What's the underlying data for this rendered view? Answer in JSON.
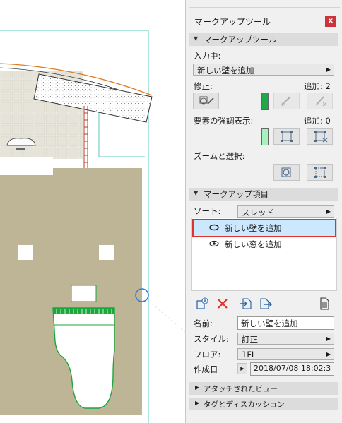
{
  "panel": {
    "title": "マークアップツール",
    "close_label": "x"
  },
  "markup_tool_section": {
    "header": "マークアップツール",
    "input_label": "入力中:",
    "input_value": "新しい壁を追加",
    "modify_label": "修正:",
    "added_label": "追加: 2",
    "highlight_label": "要素の強調表示:",
    "highlight_count": "追加: 0",
    "zoom_label": "ズームと選択:",
    "colors": {
      "modify_swatch": "#1faa4a",
      "highlight_swatch": "#a8f0c0"
    }
  },
  "markup_items_section": {
    "header": "マークアップ項目",
    "sort_label": "ソート:",
    "sort_value": "スレッド",
    "items": [
      {
        "label": "新しい壁を追加",
        "selected": true
      },
      {
        "label": "新しい窓を追加",
        "selected": false
      }
    ]
  },
  "properties": {
    "name_label": "名前:",
    "name_value": "新しい壁を追加",
    "style_label": "スタイル:",
    "style_value": "訂正",
    "floor_label": "フロア:",
    "floor_value": "1FL",
    "created_label": "作成日",
    "created_value": "2018/07/08 18:02:3"
  },
  "folds": {
    "attached_views": "アタッチされたビュー",
    "tags": "タグとディスカッション"
  },
  "colors": {
    "accent_red": "#e0322c",
    "selection_bg": "#cce8ff",
    "room_fill": "#bdb596",
    "guide_teal": "#5ec8c0",
    "fixture_green": "#1aa83a",
    "cursor_blue": "#2a7fd8"
  }
}
